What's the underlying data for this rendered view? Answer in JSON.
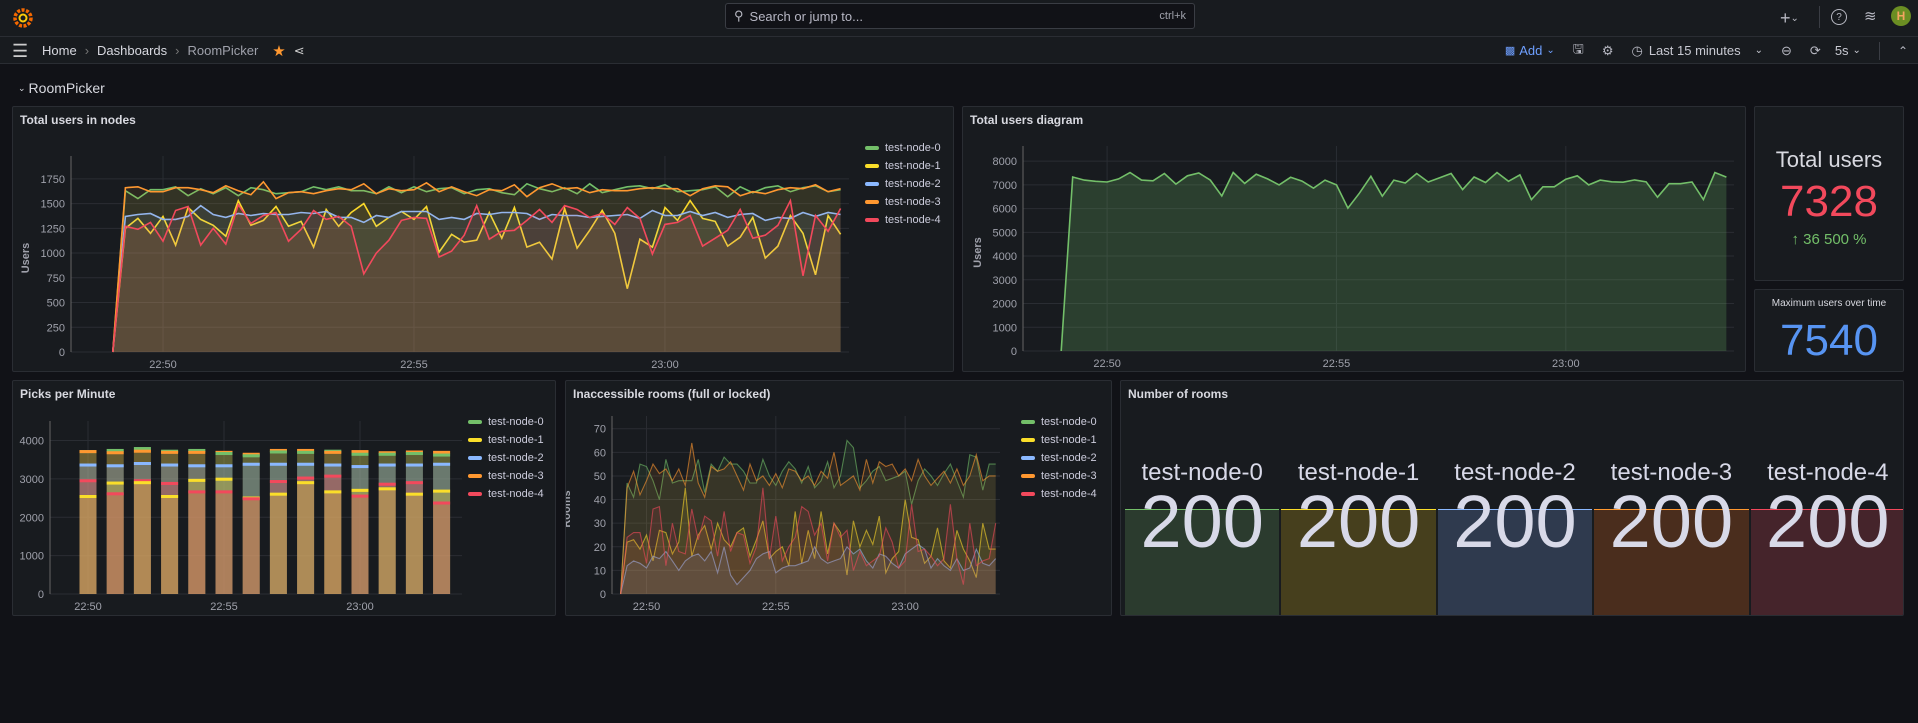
{
  "topbar": {
    "search_placeholder": "Search or jump to...",
    "shortcut": "ctrl+k"
  },
  "breadcrumb": {
    "home": "Home",
    "dashboards": "Dashboards",
    "current": "RoomPicker"
  },
  "toolbar": {
    "add_label": "Add",
    "time_range": "Last 15 minutes",
    "refresh_interval": "5s"
  },
  "section": {
    "title": "RoomPicker"
  },
  "colors": {
    "test-node-0": "#73bf69",
    "test-node-1": "#fade2a",
    "test-node-2": "#8ab8ff",
    "test-node-3": "#ff9830",
    "test-node-4": "#f2495c"
  },
  "panels": {
    "total_users_nodes": {
      "title": "Total users in nodes"
    },
    "total_users_diagram": {
      "title": "Total users diagram"
    },
    "total_users": {
      "title": "Total users",
      "value": "7328",
      "change": "36 500 %",
      "value_color": "#f2495c",
      "change_color": "#73bf69"
    },
    "max_users": {
      "title": "Maximum users over time",
      "value": "7540",
      "value_color": "#5794f2"
    },
    "picks": {
      "title": "Picks per Minute"
    },
    "inaccessible": {
      "title": "Inaccessible rooms (full or locked)"
    },
    "rooms": {
      "title": "Number of rooms",
      "tiles": [
        {
          "name": "test-node-0",
          "value": "200",
          "bg": "#2b3b2e",
          "line": "#73bf69"
        },
        {
          "name": "test-node-1",
          "value": "200",
          "bg": "#463f1d",
          "line": "#fade2a"
        },
        {
          "name": "test-node-2",
          "value": "200",
          "bg": "#2f3a4e",
          "line": "#8ab8ff"
        },
        {
          "name": "test-node-3",
          "value": "200",
          "bg": "#4a2d1d",
          "line": "#ff9830"
        },
        {
          "name": "test-node-4",
          "value": "200",
          "bg": "#45242b",
          "line": "#f2495c"
        }
      ]
    }
  },
  "chart_data": [
    {
      "type": "line",
      "title": "Total users in nodes",
      "ylabel": "Users",
      "ylim": [
        0,
        1900
      ],
      "yticks": [
        0,
        250,
        500,
        750,
        1000,
        1250,
        1500,
        1750
      ],
      "xticks": [
        "22:50",
        "22:55",
        "23:00"
      ],
      "xlim": [
        "22:48:10",
        "23:03:40"
      ],
      "grid": true,
      "legend": "right",
      "x": [
        "22:49:00",
        "22:49:15",
        "22:49:30",
        "22:49:45",
        "22:50:00",
        "22:50:15",
        "22:50:30",
        "22:50:45",
        "22:51:00",
        "22:51:15",
        "22:51:30",
        "22:51:45",
        "22:52:00",
        "22:52:15",
        "22:52:30",
        "22:52:45",
        "22:53:00",
        "22:53:15",
        "22:53:30",
        "22:53:45",
        "22:54:00",
        "22:54:15",
        "22:54:30",
        "22:54:45",
        "22:55:00",
        "22:55:15",
        "22:55:30",
        "22:55:45",
        "22:56:00",
        "22:56:15",
        "22:56:30",
        "22:56:45",
        "22:57:00",
        "22:57:15",
        "22:57:30",
        "22:57:45",
        "22:58:00",
        "22:58:15",
        "22:58:30",
        "22:58:45",
        "22:59:00",
        "22:59:15",
        "22:59:30",
        "22:59:45",
        "23:00:00",
        "23:00:15",
        "23:00:30",
        "23:00:45",
        "23:01:00",
        "23:01:15",
        "23:01:30",
        "23:01:45",
        "23:02:00",
        "23:02:15",
        "23:02:30",
        "23:02:45",
        "23:03:00",
        "23:03:15",
        "23:03:30"
      ],
      "series": [
        {
          "name": "test-node-0",
          "values": [
            0,
            1630,
            1550,
            1640,
            1640,
            1670,
            1580,
            1650,
            1600,
            1660,
            1580,
            1660,
            1640,
            1600,
            1610,
            1620,
            1670,
            1640,
            1670,
            1630,
            1630,
            1600,
            1670,
            1610,
            1670,
            1620,
            1650,
            1660,
            1600,
            1640,
            1650,
            1610,
            1590,
            1700,
            1650,
            1620,
            1660,
            1600,
            1700,
            1610,
            1640,
            1670,
            1680,
            1650,
            1690,
            1620,
            1630,
            1640,
            1670,
            1570,
            1670,
            1610,
            1660,
            1680,
            1620,
            1660,
            1680,
            1620,
            1640
          ]
        },
        {
          "name": "test-node-1",
          "values": [
            0,
            1250,
            1350,
            1200,
            1370,
            1080,
            1460,
            1340,
            1280,
            1170,
            1530,
            1280,
            1330,
            1470,
            1270,
            1320,
            1060,
            1440,
            1270,
            1410,
            1500,
            1270,
            1360,
            1420,
            1340,
            1470,
            1010,
            1190,
            1110,
            1130,
            1410,
            1150,
            1460,
            1060,
            1110,
            940,
            1450,
            1050,
            1230,
            1430,
            1200,
            640,
            1140,
            1060,
            1460,
            1330,
            1530,
            1350,
            1320,
            1070,
            1160,
            1360,
            950,
            1070,
            1380,
            1200,
            780,
            1380,
            1190
          ]
        },
        {
          "name": "test-node-2",
          "values": [
            0,
            1370,
            1390,
            1400,
            1340,
            1340,
            1370,
            1480,
            1390,
            1360,
            1400,
            1380,
            1400,
            1390,
            1390,
            1410,
            1400,
            1420,
            1360,
            1360,
            1310,
            1380,
            1360,
            1420,
            1420,
            1420,
            1340,
            1360,
            1340,
            1400,
            1390,
            1410,
            1410,
            1400,
            1340,
            1390,
            1380,
            1380,
            1360,
            1370,
            1380,
            1390,
            1350,
            1430,
            1380,
            1380,
            1420,
            1380,
            1410,
            1360,
            1390,
            1400,
            1330,
            1360,
            1350,
            1410,
            1370,
            1410,
            1390
          ]
        },
        {
          "name": "test-node-3",
          "values": [
            0,
            1660,
            1670,
            1620,
            1620,
            1660,
            1660,
            1640,
            1610,
            1680,
            1630,
            1590,
            1720,
            1550,
            1610,
            1620,
            1600,
            1630,
            1650,
            1640,
            1700,
            1600,
            1650,
            1630,
            1640,
            1710,
            1620,
            1670,
            1620,
            1580,
            1640,
            1630,
            1690,
            1570,
            1660,
            1700,
            1650,
            1660,
            1610,
            1640,
            1630,
            1630,
            1650,
            1660,
            1650,
            1650,
            1580,
            1650,
            1680,
            1670,
            1580,
            1620,
            1600,
            1640,
            1660,
            1650,
            1690,
            1620,
            1650
          ]
        },
        {
          "name": "test-node-4",
          "values": [
            0,
            1270,
            1240,
            1310,
            1120,
            1430,
            1470,
            1080,
            1250,
            1090,
            1490,
            1300,
            1380,
            1410,
            1120,
            1240,
            1430,
            1340,
            1370,
            1270,
            790,
            1000,
            1130,
            1330,
            1360,
            1350,
            960,
            1020,
            1180,
            1480,
            1140,
            1220,
            1230,
            1330,
            1440,
            1310,
            1480,
            1440,
            1360,
            1400,
            1290,
            1460,
            1350,
            990,
            1290,
            1310,
            1380,
            1070,
            1150,
            1230,
            1440,
            1150,
            1180,
            1280,
            1530,
            770,
            1380,
            1220,
            1450
          ]
        }
      ]
    },
    {
      "type": "area",
      "title": "Total users diagram",
      "ylabel": "Users",
      "ylim": [
        0,
        8300
      ],
      "yticks": [
        0,
        1000,
        2000,
        3000,
        4000,
        5000,
        6000,
        7000,
        8000
      ],
      "xticks": [
        "22:50",
        "22:55",
        "23:00"
      ],
      "xlim": [
        "22:48:10",
        "23:03:40"
      ],
      "grid": true,
      "x_from": "22:49:00",
      "x_to": "23:03:30",
      "series": [
        {
          "values": [
            0,
            7330,
            7200,
            7150,
            7120,
            7250,
            7520,
            7200,
            7170,
            7480,
            7030,
            7380,
            7500,
            7200,
            6530,
            7520,
            7060,
            7450,
            7250,
            7000,
            7320,
            7160,
            6860,
            7200,
            7000,
            6020,
            6650,
            7360,
            6520,
            7200,
            7080,
            7480,
            7120,
            7300,
            7480,
            6800,
            7330,
            7100,
            7520,
            7150,
            7420,
            6380,
            6920,
            6920,
            7240,
            7380,
            7000,
            7200,
            7130,
            7110,
            7210,
            7130,
            6480,
            7050,
            7050,
            7120,
            6380,
            7520,
            7328
          ]
        }
      ]
    },
    {
      "type": "bar",
      "title": "Picks per Minute",
      "ylim": [
        0,
        4300
      ],
      "yticks": [
        0,
        1000,
        2000,
        3000,
        4000
      ],
      "xticks": [
        "22:50",
        "22:55",
        "23:00"
      ],
      "grid": true,
      "legend": "right",
      "categories": [
        "22:50",
        "22:51",
        "22:52",
        "22:53",
        "22:54",
        "22:55",
        "22:56",
        "22:57",
        "22:58",
        "22:59",
        "23:00",
        "23:01",
        "23:02",
        "23:03"
      ],
      "series": [
        {
          "name": "test-node-0",
          "values": [
            3750,
            3780,
            3830,
            3760,
            3780,
            3700,
            3640,
            3740,
            3730,
            3760,
            3680,
            3680,
            3700,
            3660
          ]
        },
        {
          "name": "test-node-1",
          "values": [
            2580,
            2930,
            2940,
            2580,
            3000,
            3030,
            2540,
            2640,
            2940,
            2700,
            2740,
            2780,
            2640,
            2720
          ]
        },
        {
          "name": "test-node-2",
          "values": [
            3400,
            3380,
            3440,
            3400,
            3380,
            3380,
            3420,
            3420,
            3420,
            3400,
            3360,
            3400,
            3400,
            3420
          ]
        },
        {
          "name": "test-node-3",
          "values": [
            3750,
            3720,
            3760,
            3730,
            3730,
            3730,
            3680,
            3780,
            3780,
            3730,
            3750,
            3720,
            3740,
            3730
          ]
        },
        {
          "name": "test-node-4",
          "values": [
            2990,
            2650,
            2990,
            2920,
            2700,
            2700,
            2520,
            2970,
            3060,
            3110,
            2590,
            2900,
            2940,
            2410
          ]
        }
      ]
    },
    {
      "type": "line",
      "title": "Inaccessible rooms (full or locked)",
      "ylabel": "Rooms",
      "ylim": [
        0,
        72
      ],
      "yticks": [
        0,
        10,
        20,
        30,
        40,
        50,
        60,
        70
      ],
      "xticks": [
        "22:50",
        "22:55",
        "23:00"
      ],
      "xlim": [
        "22:48:40",
        "23:03:40"
      ],
      "grid": true,
      "legend": "right",
      "x_from": "22:49:00",
      "x_to": "23:03:30",
      "series": [
        {
          "name": "test-node-0",
          "values": [
            0,
            47,
            41,
            55,
            54,
            48,
            40,
            57,
            47,
            48,
            48,
            48,
            57,
            43,
            55,
            52,
            58,
            55,
            55,
            52,
            47,
            47,
            57,
            50,
            46,
            52,
            56,
            53,
            47,
            54,
            45,
            48,
            56,
            45,
            50,
            65,
            62,
            45,
            48,
            52,
            54,
            48,
            49,
            50,
            52,
            38,
            48,
            53,
            50,
            46,
            51,
            55,
            48,
            41,
            59,
            58,
            44,
            55,
            55
          ]
        },
        {
          "name": "test-node-1",
          "values": [
            0,
            22,
            23,
            19,
            25,
            14,
            27,
            26,
            17,
            22,
            45,
            16,
            25,
            29,
            19,
            30,
            23,
            20,
            26,
            28,
            16,
            23,
            31,
            15,
            18,
            20,
            12,
            35,
            13,
            27,
            15,
            35,
            17,
            30,
            26,
            8,
            31,
            20,
            27,
            21,
            33,
            9,
            15,
            18,
            40,
            24,
            23,
            13,
            16,
            28,
            14,
            11,
            27,
            19,
            14,
            7,
            30,
            19,
            19
          ]
        },
        {
          "name": "test-node-2",
          "values": [
            0,
            12,
            14,
            13,
            11,
            16,
            15,
            18,
            14,
            10,
            14,
            16,
            17,
            14,
            18,
            9,
            20,
            8,
            4,
            7,
            10,
            15,
            17,
            18,
            9,
            11,
            12,
            12,
            13,
            14,
            20,
            15,
            13,
            14,
            15,
            20,
            17,
            19,
            14,
            11,
            17,
            16,
            13,
            11,
            17,
            19,
            21,
            19,
            11,
            15,
            12,
            10,
            15,
            10,
            11,
            19,
            13,
            12,
            15
          ]
        },
        {
          "name": "test-node-3",
          "values": [
            0,
            45,
            52,
            42,
            48,
            55,
            51,
            53,
            48,
            53,
            46,
            64,
            47,
            41,
            54,
            52,
            53,
            56,
            50,
            44,
            55,
            48,
            50,
            46,
            51,
            45,
            53,
            52,
            48,
            50,
            46,
            52,
            49,
            60,
            46,
            48,
            50,
            44,
            57,
            47,
            56,
            54,
            55,
            50,
            53,
            48,
            57,
            50,
            46,
            49,
            52,
            47,
            53,
            46,
            50,
            59,
            48,
            50,
            50
          ]
        },
        {
          "name": "test-node-4",
          "values": [
            0,
            24,
            26,
            26,
            13,
            36,
            37,
            12,
            30,
            18,
            17,
            36,
            23,
            33,
            31,
            16,
            35,
            18,
            26,
            25,
            13,
            20,
            45,
            15,
            33,
            14,
            20,
            24,
            37,
            35,
            25,
            30,
            14,
            30,
            24,
            27,
            10,
            18,
            12,
            14,
            16,
            28,
            22,
            11,
            14,
            38,
            18,
            19,
            16,
            12,
            15,
            38,
            15,
            4,
            30,
            12,
            14,
            15,
            30
          ]
        }
      ]
    }
  ]
}
